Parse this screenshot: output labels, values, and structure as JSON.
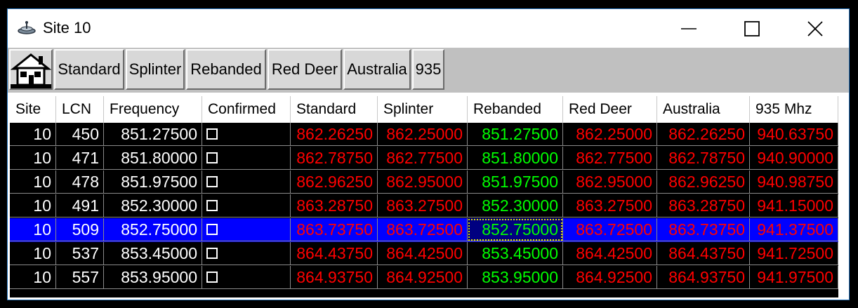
{
  "window": {
    "title": "Site 10",
    "app_icon": "satellite-dish-icon"
  },
  "titlebar_buttons": {
    "minimize": "minimize-icon",
    "maximize": "maximize-icon",
    "close": "close-icon"
  },
  "toolbar": {
    "home_icon": "house-icon",
    "buttons": [
      "Standard",
      "Splinter",
      "Rebanded",
      "Red Deer",
      "Australia",
      "935"
    ]
  },
  "table": {
    "columns": [
      "Site",
      "LCN",
      "Frequency",
      "Confirmed",
      "Standard",
      "Splinter",
      "Rebanded",
      "Red Deer",
      "Australia",
      "935 Mhz"
    ],
    "rows": [
      [
        "10",
        "450",
        "851.27500",
        "",
        "862.26250",
        "862.25000",
        "851.27500",
        "862.25000",
        "862.26250",
        "940.63750"
      ],
      [
        "10",
        "471",
        "851.80000",
        "",
        "862.78750",
        "862.77500",
        "851.80000",
        "862.77500",
        "862.78750",
        "940.90000"
      ],
      [
        "10",
        "478",
        "851.97500",
        "",
        "862.96250",
        "862.95000",
        "851.97500",
        "862.95000",
        "862.96250",
        "940.98750"
      ],
      [
        "10",
        "491",
        "852.30000",
        "",
        "863.28750",
        "863.27500",
        "852.30000",
        "863.27500",
        "863.28750",
        "941.15000"
      ],
      [
        "10",
        "509",
        "852.75000",
        "",
        "863.73750",
        "863.72500",
        "852.75000",
        "863.72500",
        "863.73750",
        "941.37500"
      ],
      [
        "10",
        "537",
        "853.45000",
        "",
        "864.43750",
        "864.42500",
        "853.45000",
        "864.42500",
        "864.43750",
        "941.72500"
      ],
      [
        "10",
        "557",
        "853.95000",
        "",
        "864.93750",
        "864.92500",
        "853.95000",
        "864.92500",
        "864.93750",
        "941.97500"
      ]
    ],
    "selected_row": 4,
    "focused_column": 6,
    "colors": {
      "normal_text": "#ffffff",
      "offset_text": "#ff0000",
      "rebanded_text": "#00ff00",
      "selection": "#0000ff"
    }
  }
}
